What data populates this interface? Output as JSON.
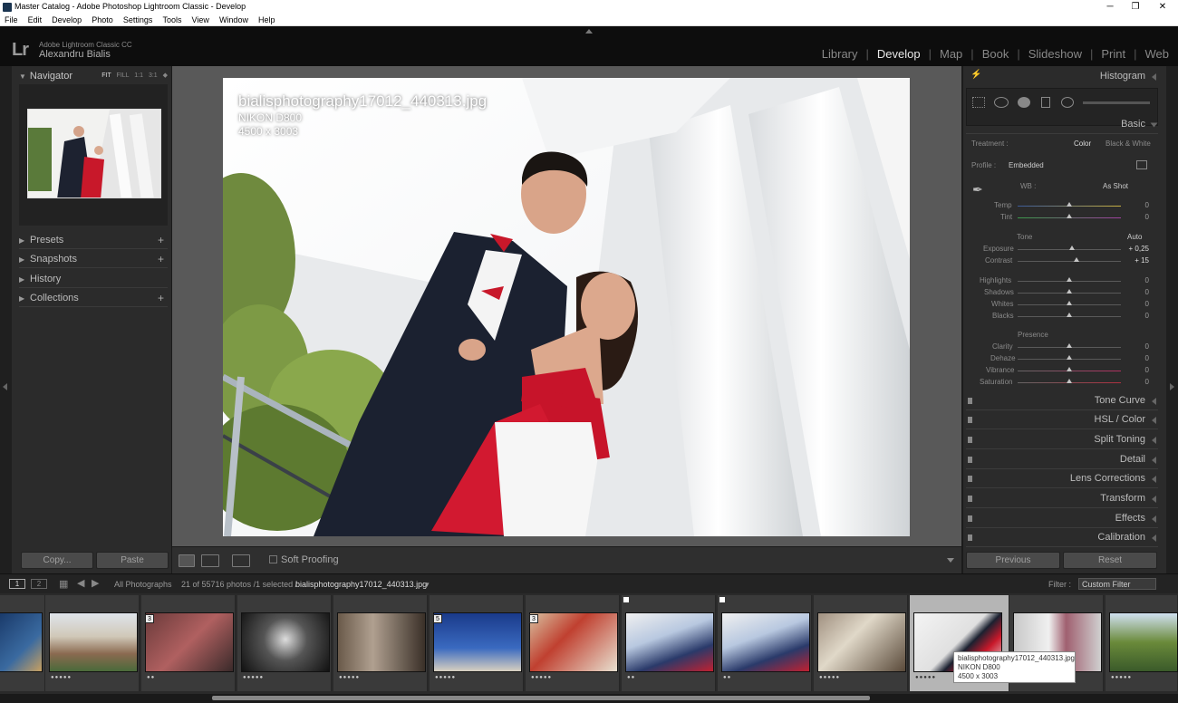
{
  "window": {
    "title": "Master Catalog - Adobe Photoshop Lightroom Classic - Develop"
  },
  "menu": [
    "File",
    "Edit",
    "Develop",
    "Photo",
    "Settings",
    "Tools",
    "View",
    "Window",
    "Help"
  ],
  "identity": {
    "logo": "Lr",
    "product": "Adobe Lightroom Classic CC",
    "user": "Alexandru Bialis"
  },
  "modules": [
    "Library",
    "Develop",
    "Map",
    "Book",
    "Slideshow",
    "Print",
    "Web"
  ],
  "active_module": "Develop",
  "left": {
    "navigator": {
      "label": "Navigator",
      "opts": [
        "FIT",
        "FILL",
        "1:1",
        "3:1"
      ]
    },
    "panels": [
      "Presets",
      "Snapshots",
      "History",
      "Collections"
    ],
    "copy_label": "Copy...",
    "paste_label": "Paste"
  },
  "photo": {
    "filename": "bialisphotography17012_440313.jpg",
    "camera": "NIKON D800",
    "dimensions": "4500 x 3003"
  },
  "toolbar": {
    "soft_proofing": "Soft Proofing"
  },
  "right": {
    "histogram": "Histogram",
    "basic": "Basic",
    "treatment_label": "Treatment :",
    "treatment_color": "Color",
    "treatment_bw": "Black & White",
    "profile_label": "Profile :",
    "profile_value": "Embedded",
    "wb_label": "WB :",
    "wb_value": "As Shot",
    "temp": {
      "label": "Temp",
      "value": "0"
    },
    "tint": {
      "label": "Tint",
      "value": "0"
    },
    "tone_label": "Tone",
    "auto_label": "Auto",
    "exposure": {
      "label": "Exposure",
      "value": "+ 0,25"
    },
    "contrast": {
      "label": "Contrast",
      "value": "+ 15"
    },
    "highlights": {
      "label": "Highlights",
      "value": "0"
    },
    "shadows": {
      "label": "Shadows",
      "value": "0"
    },
    "whites": {
      "label": "Whites",
      "value": "0"
    },
    "blacks": {
      "label": "Blacks",
      "value": "0"
    },
    "presence_label": "Presence",
    "clarity": {
      "label": "Clarity",
      "value": "0"
    },
    "dehaze": {
      "label": "Dehaze",
      "value": "0"
    },
    "vibrance": {
      "label": "Vibrance",
      "value": "0"
    },
    "saturation": {
      "label": "Saturation",
      "value": "0"
    },
    "panels": [
      "Tone Curve",
      "HSL / Color",
      "Split Toning",
      "Detail",
      "Lens Corrections",
      "Transform",
      "Effects",
      "Calibration"
    ],
    "previous_label": "Previous",
    "reset_label": "Reset"
  },
  "filmstrip": {
    "source": "All Photographs",
    "count": "21 of 55716 photos /1 selected /",
    "current": "bialisphotography17012_440313.jpg",
    "filter_label": "Filter :",
    "filter_value": "Custom Filter",
    "tooltip": {
      "filename": "bialisphotography17012_440313.jpg",
      "camera": "NIKON D800",
      "dimensions": "4500 x 3003"
    },
    "badges": [
      "3",
      "5",
      "3"
    ]
  }
}
